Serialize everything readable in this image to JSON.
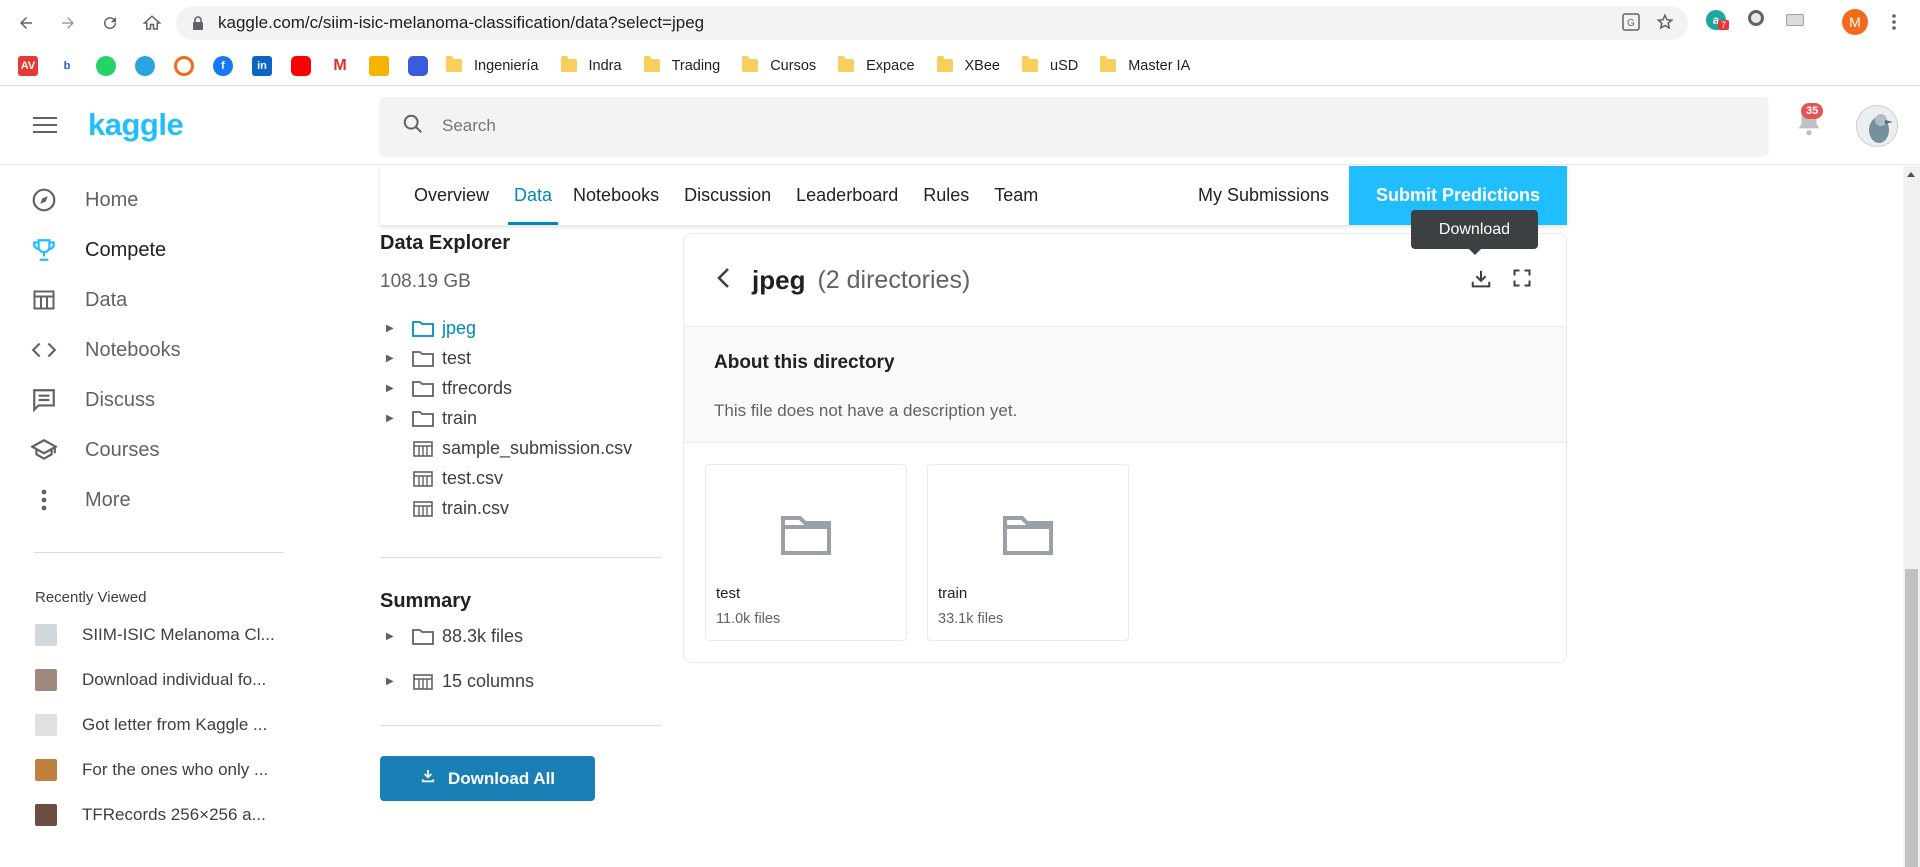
{
  "browser": {
    "url": "kaggle.com/c/siim-isic-melanoma-classification/data?select=jpeg",
    "bookmark_folders": [
      "Ingeniería",
      "Indra",
      "Trading",
      "Cursos",
      "Expace",
      "XBee",
      "uSD",
      "Master IA"
    ],
    "ext_badge": "7",
    "profile_initial": "M"
  },
  "header": {
    "logo": "kaggle",
    "search_placeholder": "Search",
    "notification_count": "35"
  },
  "sidebar": {
    "items": [
      {
        "label": "Home",
        "icon": "compass-icon"
      },
      {
        "label": "Compete",
        "icon": "trophy-icon"
      },
      {
        "label": "Data",
        "icon": "table-icon"
      },
      {
        "label": "Notebooks",
        "icon": "code-icon"
      },
      {
        "label": "Discuss",
        "icon": "comment-icon"
      },
      {
        "label": "Courses",
        "icon": "school-icon"
      },
      {
        "label": "More",
        "icon": "more-vert-icon"
      }
    ],
    "recently_viewed_title": "Recently Viewed",
    "recent": [
      "SIIM-ISIC Melanoma Cl...",
      "Download individual fo...",
      "Got letter from Kaggle ...",
      "For the ones who only ...",
      "TFRecords 256×256 a..."
    ]
  },
  "tabs": {
    "items": [
      "Overview",
      "Data",
      "Notebooks",
      "Discussion",
      "Leaderboard",
      "Rules",
      "Team"
    ],
    "active": "Data",
    "my_submissions": "My Submissions",
    "submit": "Submit Predictions"
  },
  "explorer": {
    "title": "Data Explorer",
    "size": "108.19 GB",
    "tree": [
      {
        "name": "jpeg",
        "type": "folder"
      },
      {
        "name": "test",
        "type": "folder"
      },
      {
        "name": "tfrecords",
        "type": "folder"
      },
      {
        "name": "train",
        "type": "folder"
      },
      {
        "name": "sample_submission.csv",
        "type": "table"
      },
      {
        "name": "test.csv",
        "type": "table"
      },
      {
        "name": "train.csv",
        "type": "table"
      }
    ],
    "summary_title": "Summary",
    "summary_files": "88.3k files",
    "summary_columns": "15 columns",
    "download_all": "Download All"
  },
  "panel": {
    "title": "jpeg",
    "subtitle": "(2 directories)",
    "tooltip": "Download",
    "about_title": "About this directory",
    "about_text": "This file does not have a description yet.",
    "cards": [
      {
        "name": "test",
        "count": "11.0k files"
      },
      {
        "name": "train",
        "count": "33.1k files"
      }
    ]
  }
}
